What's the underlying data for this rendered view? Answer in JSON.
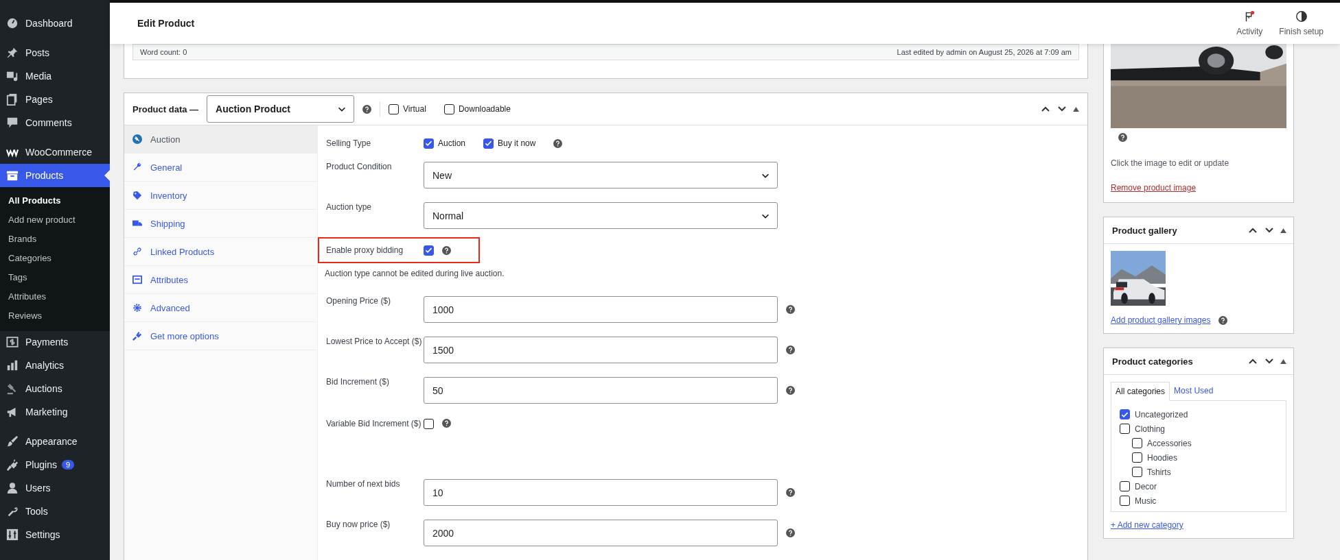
{
  "sidebar": {
    "groups": [
      [
        {
          "label": "Dashboard",
          "selected": false
        }
      ],
      [
        {
          "label": "Posts",
          "selected": false
        },
        {
          "label": "Media",
          "selected": false
        },
        {
          "label": "Pages",
          "selected": false
        },
        {
          "label": "Comments",
          "selected": false
        }
      ],
      [
        {
          "label": "WooCommerce",
          "selected": false
        },
        {
          "label": "Products",
          "selected": true,
          "expanded": true,
          "children": [
            {
              "label": "All Products",
              "selected": true
            },
            {
              "label": "Add new product",
              "selected": false
            },
            {
              "label": "Brands",
              "selected": false
            },
            {
              "label": "Categories",
              "selected": false
            },
            {
              "label": "Tags",
              "selected": false
            },
            {
              "label": "Attributes",
              "selected": false
            },
            {
              "label": "Reviews",
              "selected": false
            }
          ]
        },
        {
          "label": "Payments",
          "selected": false
        },
        {
          "label": "Analytics",
          "selected": false
        },
        {
          "label": "Auctions",
          "selected": false
        },
        {
          "label": "Marketing",
          "selected": false
        }
      ],
      [
        {
          "label": "Appearance",
          "selected": false
        },
        {
          "label": "Plugins",
          "selected": false,
          "badge": "9"
        },
        {
          "label": "Users",
          "selected": false
        },
        {
          "label": "Tools",
          "selected": false
        },
        {
          "label": "Settings",
          "selected": false
        }
      ]
    ]
  },
  "header": {
    "title": "Edit Product",
    "actions": [
      {
        "label": "Activity",
        "notification": true
      },
      {
        "label": "Finish setup",
        "notification": false
      }
    ]
  },
  "editor_footer": {
    "word_count": "Word count: 0",
    "last_edited": "Last edited by admin on August 25, 2026 at 7:09 am"
  },
  "product_data": {
    "title": "Product data —",
    "type": "Auction Product",
    "options": [
      {
        "label": "Virtual",
        "checked": false
      },
      {
        "label": "Downloadable",
        "checked": false
      }
    ],
    "tabs": [
      {
        "label": "Auction",
        "selected": true
      },
      {
        "label": "General",
        "selected": false
      },
      {
        "label": "Inventory",
        "selected": false
      },
      {
        "label": "Shipping",
        "selected": false
      },
      {
        "label": "Linked Products",
        "selected": false
      },
      {
        "label": "Attributes",
        "selected": false
      },
      {
        "label": "Advanced",
        "selected": false
      },
      {
        "label": "Get more options",
        "selected": false
      }
    ],
    "fields": [
      {
        "kind": "checks",
        "label": "Selling Type",
        "help": true,
        "highlighted": false,
        "options": [
          {
            "label": "Auction",
            "checked": true
          },
          {
            "label": "Buy it now",
            "checked": true
          }
        ]
      },
      {
        "kind": "select",
        "label": "Product Condition",
        "value": "New",
        "help": false,
        "highlighted": false
      },
      {
        "kind": "select",
        "label": "Auction type",
        "value": "Normal",
        "help": false,
        "highlighted": false
      },
      {
        "kind": "checkbox",
        "label": "Enable proxy bidding",
        "checked": true,
        "help": true,
        "highlighted": true
      },
      {
        "kind": "note",
        "text": "Auction type cannot be edited during live auction."
      },
      {
        "kind": "input",
        "label": "Opening Price ($)",
        "value": "1000",
        "help": true,
        "highlighted": false
      },
      {
        "kind": "input",
        "label": "Lowest Price to Accept ($)",
        "value": "1500",
        "help": true,
        "highlighted": false
      },
      {
        "kind": "input",
        "label": "Bid Increment ($)",
        "value": "50",
        "help": true,
        "highlighted": false
      },
      {
        "kind": "checkbox",
        "label": "Variable Bid Increment ($)",
        "checked": false,
        "help": true,
        "highlighted": false
      },
      {
        "kind": "input",
        "label": "Number of next bids",
        "value": "10",
        "help": true,
        "highlighted": false
      },
      {
        "kind": "input",
        "label": "Buy now price ($)",
        "value": "2000",
        "help": true,
        "highlighted": false
      }
    ]
  },
  "product_image": {
    "hint": "Click the image to edit or update",
    "remove_link": "Remove product image"
  },
  "product_gallery": {
    "title": "Product gallery",
    "add_link": "Add product gallery images"
  },
  "product_categories": {
    "title": "Product categories",
    "tabs": [
      {
        "label": "All categories",
        "selected": true
      },
      {
        "label": "Most Used",
        "selected": false
      }
    ],
    "items": [
      {
        "label": "Uncategorized",
        "checked": true
      },
      {
        "label": "Clothing",
        "checked": false,
        "children": [
          {
            "label": "Accessories",
            "checked": false
          },
          {
            "label": "Hoodies",
            "checked": false
          },
          {
            "label": "Tshirts",
            "checked": false
          }
        ]
      },
      {
        "label": "Decor",
        "checked": false
      },
      {
        "label": "Music",
        "checked": false
      }
    ],
    "add_link": "+ Add new category"
  }
}
